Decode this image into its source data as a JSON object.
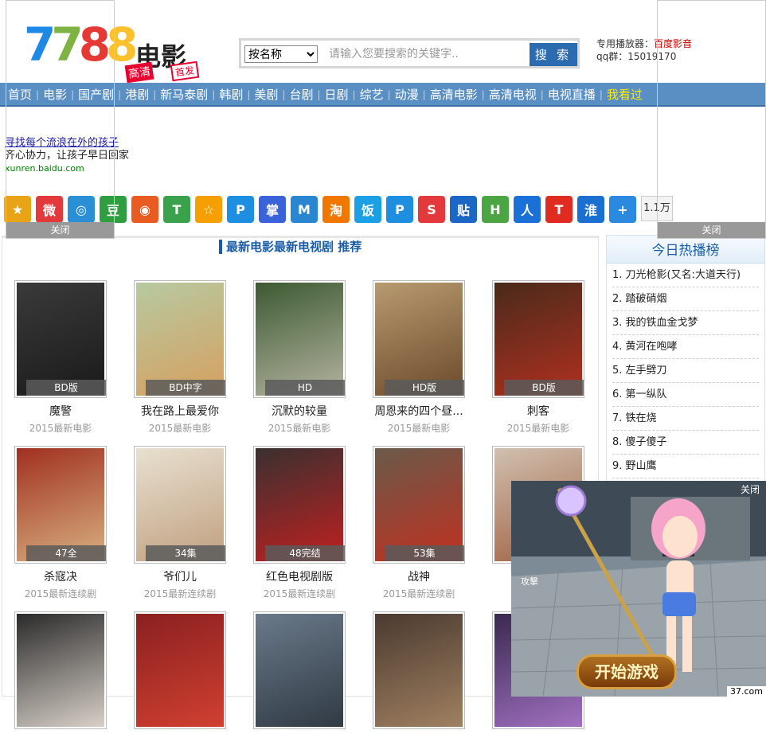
{
  "header": {
    "logo_number": "7788",
    "logo_cn": "电影",
    "logo_tag1": "高清",
    "logo_tag2": "首发",
    "search_select": "按名称",
    "search_placeholder": "请输入您要搜索的关键字..",
    "search_button": "搜 索",
    "player_label": "专用播放器：",
    "player_link": "百度影音",
    "qq_label": "qq群：",
    "qq_value": "15019170"
  },
  "nav": [
    "首页",
    "电影",
    "国产剧",
    "港剧",
    "新马泰剧",
    "韩剧",
    "美剧",
    "台剧",
    "日剧",
    "综艺",
    "动漫",
    "高清电影",
    "高清电视",
    "电视直播",
    "我看过"
  ],
  "ads": {
    "left_close": "关闭",
    "right_close": "关闭",
    "text_link": "寻找每个流浪在外的孩子",
    "text_line2": "齐心协力，让孩子早日回家",
    "text_url": "xunren.baidu.com"
  },
  "share": {
    "count": "1.1万",
    "icons": [
      "qzone-icon",
      "weibo-icon",
      "tencent-weibo-icon",
      "douban-icon",
      "pengyou-icon",
      "t-icon",
      "kaixin-icon",
      "qq-icon",
      "baidu-icon",
      "msn-icon",
      "taobao-icon",
      "fan-icon",
      "qq2-icon",
      "sohu-icon",
      "tieba-icon",
      "baidu-hi-icon",
      "renren-icon",
      "tianya-icon",
      "huaban-icon",
      "more-icon"
    ]
  },
  "main": {
    "title": "最新电影最新电视剧 推荐",
    "items": [
      {
        "name": "魔警",
        "label": "BD版",
        "sub": "2015最新电影"
      },
      {
        "name": "我在路上最爱你",
        "label": "BD中字",
        "sub": "2015最新电影"
      },
      {
        "name": "沉默的较量",
        "label": "HD",
        "sub": "2015最新电影"
      },
      {
        "name": "周恩来的四个昼...",
        "label": "HD版",
        "sub": "2015最新电影"
      },
      {
        "name": "刺客",
        "label": "BD版",
        "sub": "2015最新电影"
      },
      {
        "name": "杀寇决",
        "label": "47全",
        "sub": "2015最新连续剧"
      },
      {
        "name": "爷们儿",
        "label": "34集",
        "sub": "2015最新连续剧"
      },
      {
        "name": "红色电视剧版",
        "label": "48完结",
        "sub": "2015最新连续剧"
      },
      {
        "name": "战神",
        "label": "53集",
        "sub": "2015最新连续剧"
      },
      {
        "name": "",
        "label": "",
        "sub": ""
      },
      {
        "name": "",
        "label": "",
        "sub": ""
      },
      {
        "name": "",
        "label": "",
        "sub": ""
      },
      {
        "name": "",
        "label": "",
        "sub": ""
      },
      {
        "name": "",
        "label": "",
        "sub": ""
      },
      {
        "name": "",
        "label": "",
        "sub": ""
      }
    ]
  },
  "side": {
    "title": "今日热播榜",
    "items": [
      "1. 刀光枪影(又名:大道天行)",
      "2. 踏破硝烟",
      "3. 我的铁血金戈梦",
      "4. 黄河在咆哮",
      "5. 左手劈刀",
      "6. 第一纵队",
      "7. 铁在烧",
      "8. 傻子傻子",
      "9. 野山鹰"
    ]
  },
  "game": {
    "close": "关闭",
    "start": "开始游戏",
    "attack": "攻撃",
    "brand": "37.com"
  }
}
